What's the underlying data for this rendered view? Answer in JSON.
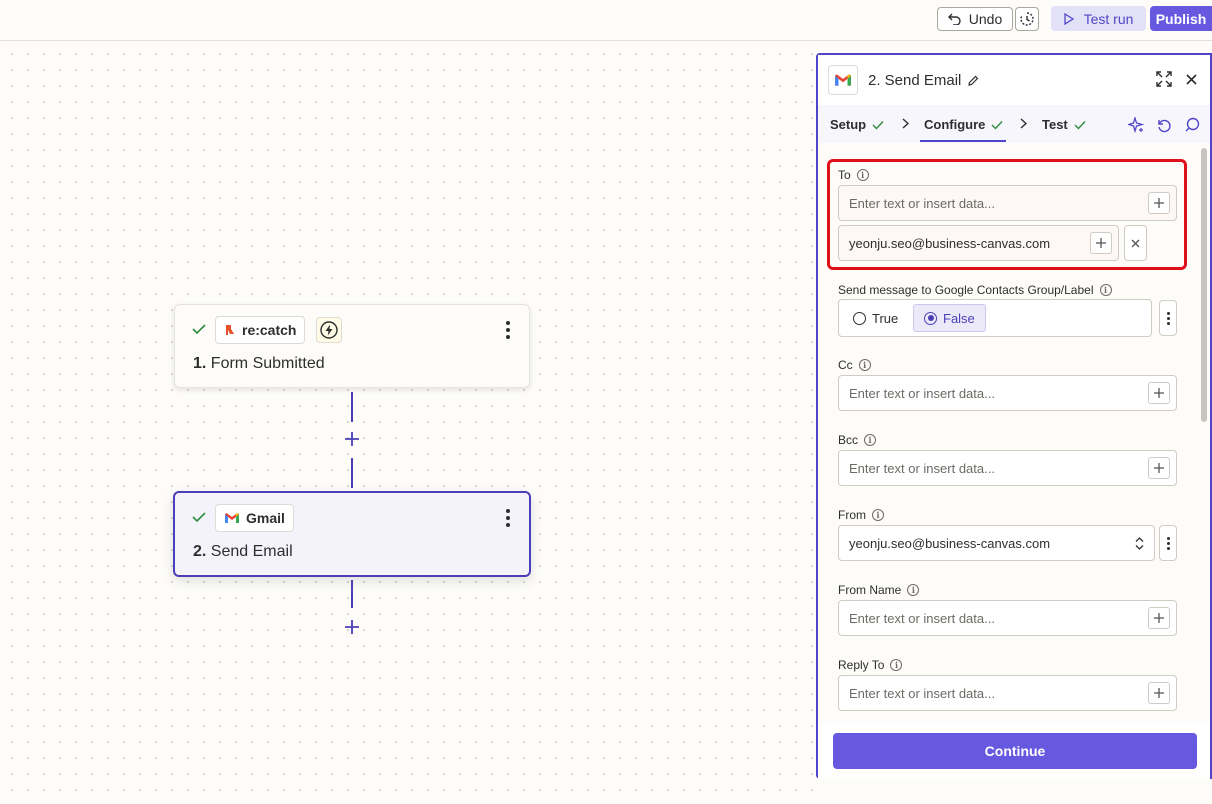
{
  "toolbar": {
    "undo_label": "Undo",
    "test_run_label": "Test run",
    "publish_label": "Publish"
  },
  "canvas": {
    "steps": [
      {
        "app": "re:catch",
        "number": "1.",
        "title": "Form Submitted",
        "status": "complete",
        "trigger": true
      },
      {
        "app": "Gmail",
        "number": "2.",
        "title": "Send Email",
        "status": "complete",
        "selected": true
      }
    ]
  },
  "panel": {
    "title": "2. Send Email",
    "tabs": [
      {
        "label": "Setup",
        "done": true
      },
      {
        "label": "Configure",
        "done": true,
        "active": true
      },
      {
        "label": "Test",
        "done": true
      }
    ],
    "fields": {
      "to": {
        "label": "To",
        "placeholder": "Enter text or insert data...",
        "values": [
          "yeonju.seo@business-canvas.com"
        ]
      },
      "contacts_group": {
        "label": "Send message to Google Contacts Group/Label",
        "options": [
          "True",
          "False"
        ],
        "selected": "False"
      },
      "cc": {
        "label": "Cc",
        "placeholder": "Enter text or insert data..."
      },
      "bcc": {
        "label": "Bcc",
        "placeholder": "Enter text or insert data..."
      },
      "from": {
        "label": "From",
        "value": "yeonju.seo@business-canvas.com"
      },
      "from_name": {
        "label": "From Name",
        "placeholder": "Enter text or insert data..."
      },
      "reply_to": {
        "label": "Reply To",
        "placeholder": "Enter text or insert data..."
      }
    },
    "continue_label": "Continue"
  },
  "colors": {
    "accent": "#6659e0",
    "accent_dark": "#4a3fb8",
    "success": "#2e8b3e",
    "highlight": "#e0101a",
    "recatch_brand": "#e8502a"
  },
  "icons": [
    "undo-icon",
    "history-icon",
    "play-icon",
    "check-icon",
    "recatch-logo-icon",
    "bolt-icon",
    "gmail-logo-icon",
    "pencil-icon",
    "expand-icon",
    "close-icon",
    "chevron-right-icon",
    "sparkle-icon",
    "refresh-icon",
    "comment-icon",
    "plus-icon",
    "info-icon",
    "updown-chevron-icon",
    "kebab-icon"
  ]
}
